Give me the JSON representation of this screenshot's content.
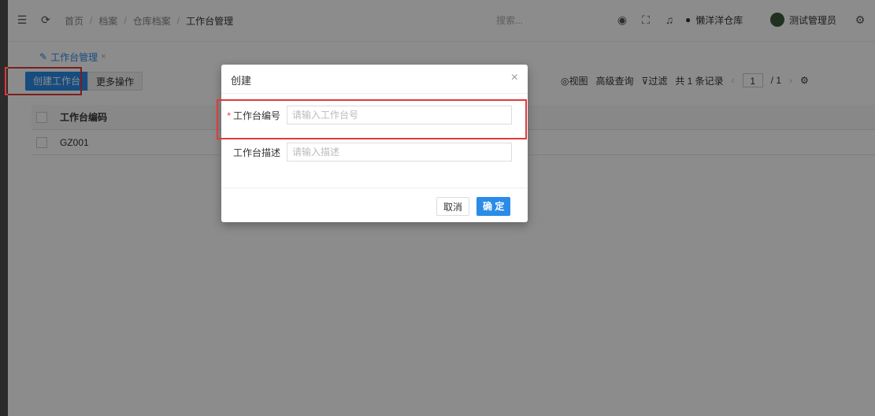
{
  "header": {
    "icons": [
      "menu-icon",
      "refresh-icon"
    ],
    "breadcrumb": [
      "首页",
      "档案",
      "仓库档案",
      "工作台管理"
    ],
    "search_placeholder": "搜索...",
    "warehouse": "懒洋洋仓库",
    "user_name": "测试管理员"
  },
  "tabs": [
    {
      "label": "工作台管理",
      "closable": true
    }
  ],
  "toolbar": {
    "create_label": "创建工作台",
    "more_label": "更多操作",
    "view_label": "视图",
    "advanced_query_label": "高级查询",
    "filter_label": "过滤",
    "record_count_label": "共 1 条记录",
    "page_current": "1",
    "page_total": "/ 1"
  },
  "table": {
    "columns": [
      "工作台编码"
    ],
    "rows": [
      {
        "code": "GZ001"
      }
    ]
  },
  "modal": {
    "title": "创建",
    "fields": [
      {
        "label": "工作台编号",
        "required": true,
        "value": "",
        "placeholder": "请输入工作台号"
      },
      {
        "label": "工作台描述",
        "required": false,
        "value": "",
        "placeholder": "请输入描述"
      }
    ],
    "cancel_label": "取消",
    "confirm_label": "确 定"
  },
  "colors": {
    "primary": "#2b8be8",
    "highlight": "#e03a3a",
    "overlay": "rgba(0,0,0,0.45)"
  }
}
